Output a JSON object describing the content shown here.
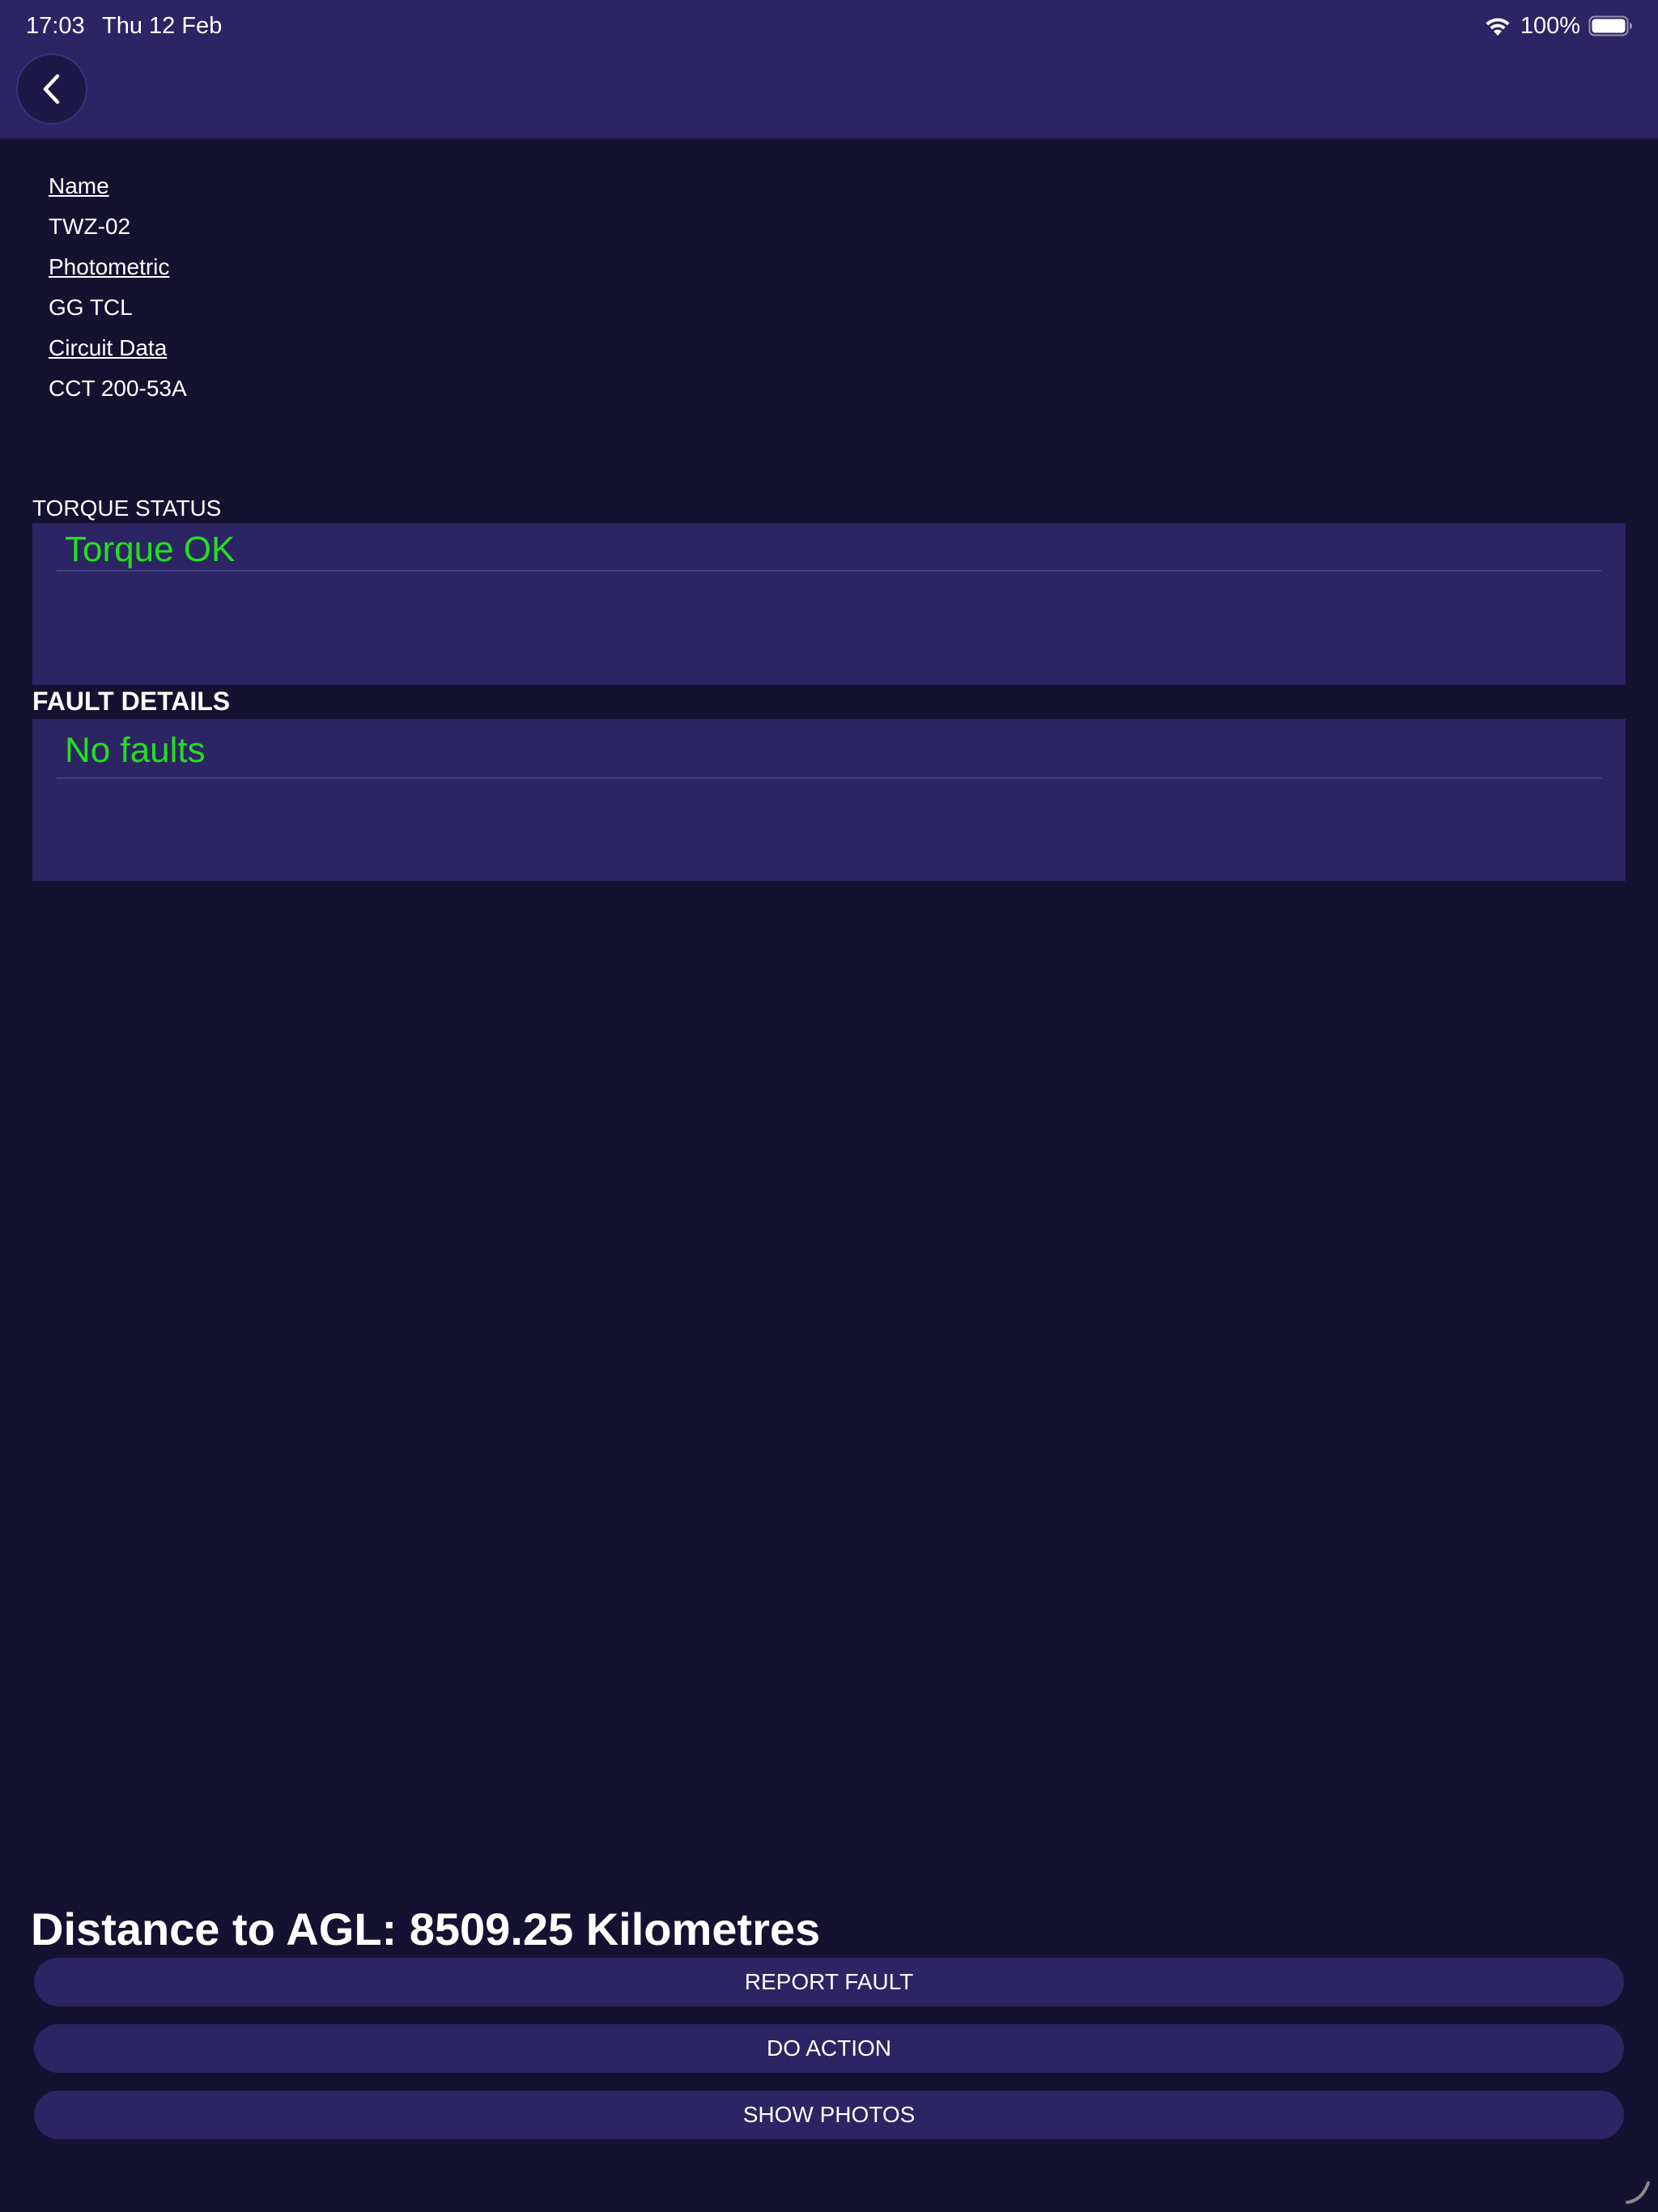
{
  "status_bar": {
    "time": "17:03",
    "date": "Thu 12 Feb",
    "battery_percent": "100%",
    "icons": [
      "wifi-icon",
      "battery-icon"
    ]
  },
  "nav": {
    "back_icon": "chevron-left-icon"
  },
  "details": {
    "name_label": "Name",
    "name_value": "TWZ-02",
    "photometric_label": "Photometric",
    "photometric_value": "GG TCL",
    "circuit_label": "Circuit Data",
    "circuit_value": "CCT 200-53A"
  },
  "torque": {
    "header": "TORQUE STATUS",
    "status": "Torque OK"
  },
  "faults": {
    "header": "FAULT DETAILS",
    "status": "No faults"
  },
  "distance_text": "Distance to AGL: 8509.25 Kilometres",
  "buttons": {
    "report_fault": "REPORT FAULT",
    "do_action": "DO ACTION",
    "show_photos": "SHOW PHOTOS"
  },
  "colors": {
    "background": "#151130",
    "panel": "#2c2463",
    "ok_green": "#23e01f"
  }
}
